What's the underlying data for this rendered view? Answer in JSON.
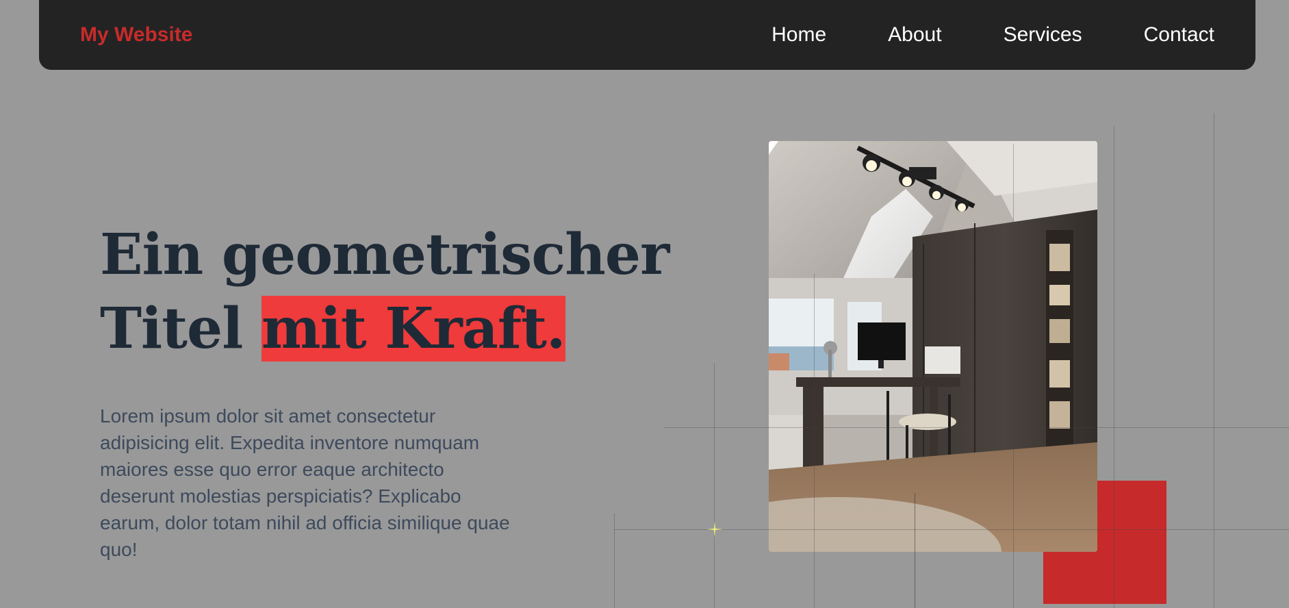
{
  "navbar": {
    "brand": "My Website",
    "links": [
      {
        "label": "Home"
      },
      {
        "label": "About"
      },
      {
        "label": "Services"
      },
      {
        "label": "Contact"
      }
    ]
  },
  "hero": {
    "title_line1": "Ein geometrischer",
    "title_line2_prefix": "Titel ",
    "title_highlight": "mit Kraft.",
    "body": "Lorem ipsum dolor sit amet consectetur adipisicing elit. Expedita inventore numquam maiores esse quo error eaque architecto deserunt molestias perspiciatis? Explicabo earum, dolor totam nihil ad officia similique quae quo!"
  },
  "colors": {
    "background": "#999999",
    "navbar": "#232323",
    "brand": "#c82b2b",
    "title": "#1f2a37",
    "highlight": "#ef3b3b",
    "accent_block": "#c62a2a"
  }
}
